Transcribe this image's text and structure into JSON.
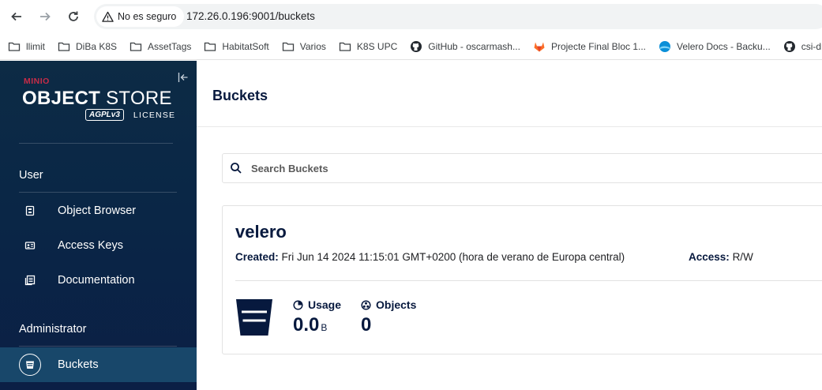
{
  "browser": {
    "security_label": "No es seguro",
    "url": "172.26.0.196:9001/buckets",
    "bookmarks": [
      {
        "label": "llimit",
        "icon": "folder-icon"
      },
      {
        "label": "DiBa K8S",
        "icon": "folder-icon"
      },
      {
        "label": "AssetTags",
        "icon": "folder-icon"
      },
      {
        "label": "HabitatSoft",
        "icon": "folder-icon"
      },
      {
        "label": "Varios",
        "icon": "folder-icon"
      },
      {
        "label": "K8S UPC",
        "icon": "folder-icon"
      },
      {
        "label": "GitHub - oscarmash...",
        "icon": "github-icon"
      },
      {
        "label": "Projecte Final Bloc 1...",
        "icon": "gitlab-icon"
      },
      {
        "label": "Velero Docs - Backu...",
        "icon": "velero-icon"
      },
      {
        "label": "csi-dr",
        "icon": "github-icon"
      }
    ]
  },
  "sidebar": {
    "logo": {
      "brand": "MINIO",
      "title_bold": "OBJECT",
      "title_light": " STORE",
      "badge": "AGPLv3",
      "license": "LICENSE"
    },
    "user_section": {
      "title": "User",
      "items": [
        {
          "label": "Object Browser",
          "icon": "object-browser-icon"
        },
        {
          "label": "Access Keys",
          "icon": "access-keys-icon"
        },
        {
          "label": "Documentation",
          "icon": "documentation-icon"
        }
      ]
    },
    "admin_section": {
      "title": "Administrator",
      "items": [
        {
          "label": "Buckets",
          "icon": "bucket-icon",
          "active": true
        }
      ]
    }
  },
  "main": {
    "title": "Buckets",
    "search": {
      "placeholder": "Search Buckets",
      "value": ""
    },
    "buckets": [
      {
        "name": "velero",
        "created_label": "Created:",
        "created_value": "Fri Jun 14 2024 11:15:01 GMT+0200 (hora de verano de Europa central)",
        "access_label": "Access:",
        "access_value": "R/W",
        "usage_label": "Usage",
        "usage_value": "0.0",
        "usage_unit": "B",
        "objects_label": "Objects",
        "objects_value": "0"
      }
    ]
  },
  "colors": {
    "sidebar_bg": "#0b2746",
    "active_item": "#18476a",
    "brand_red": "#c72c48",
    "text_dark": "#07193e"
  }
}
